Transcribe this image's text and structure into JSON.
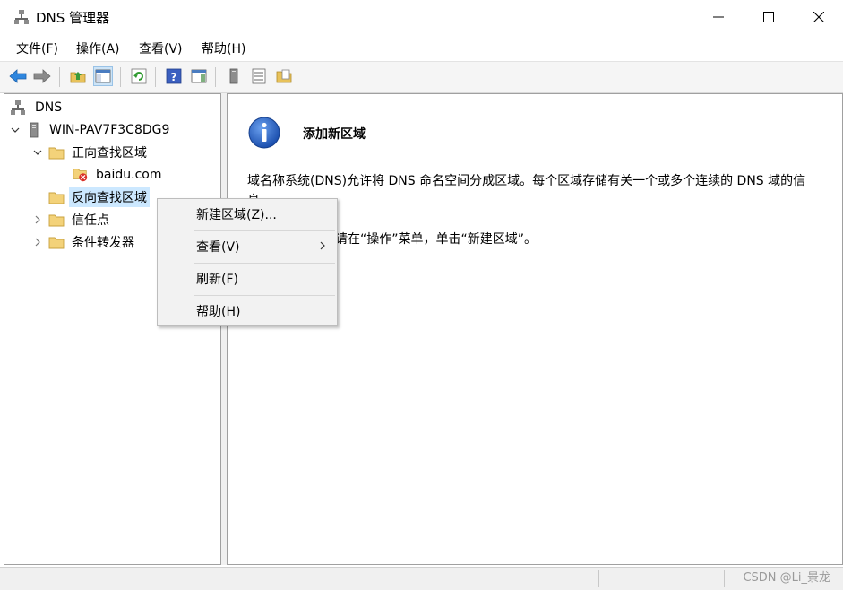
{
  "window": {
    "title": "DNS 管理器",
    "controls": [
      "minimize-button",
      "maximize-button",
      "close-button"
    ]
  },
  "menubar": {
    "items": [
      {
        "label": "文件(F)"
      },
      {
        "label": "操作(A)"
      },
      {
        "label": "查看(V)"
      },
      {
        "label": "帮助(H)"
      }
    ]
  },
  "toolbar": {
    "buttons": [
      "back-icon",
      "forward-icon",
      "up-folder-icon",
      "show-hide-console-tree-icon",
      "refresh-icon",
      "help-icon",
      "action-pane-icon",
      "server-icon",
      "list-icon",
      "folder-properties-icon"
    ]
  },
  "tree": {
    "root": "DNS",
    "server": "WIN-PAV7F3C8DG9",
    "forward_zones": "正向查找区域",
    "zone": "baidu.com",
    "reverse_zones": "反向查找区域",
    "trust_points": "信任点",
    "conditional_forwarders": "条件转发器"
  },
  "content": {
    "title": "添加新区域",
    "description": "域名称系统(DNS)允许将 DNS 命名空间分成区域。每个区域存储有关一个或多个连续的 DNS 域的信息。",
    "instruction": "要添加新区域，请在“操作”菜单，单击“新建区域”。"
  },
  "context_menu": {
    "new_zone": "新建区域(Z)...",
    "view": "查看(V)",
    "refresh": "刷新(F)",
    "help": "帮助(H)"
  },
  "watermark": "CSDN @Li_景龙",
  "colors": {
    "selection": "#cce8ff",
    "info_blue": "#1f5fbf",
    "folder_yellow": "#e8c25a"
  }
}
